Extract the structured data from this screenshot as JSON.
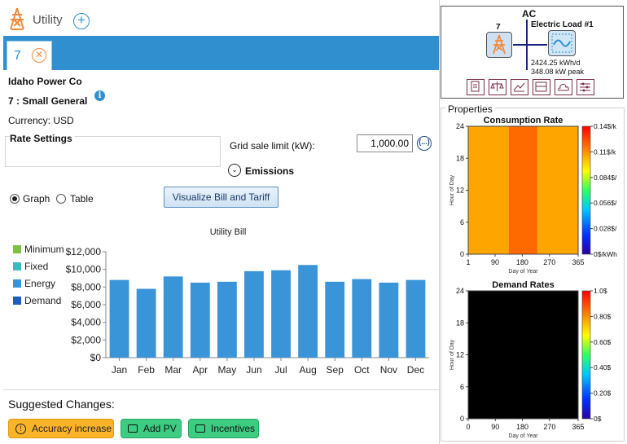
{
  "app": {
    "title": "Utility"
  },
  "tabs": [
    {
      "label": "7"
    }
  ],
  "utility": {
    "company": "Idaho Power Co",
    "rate_name": "7 : Small General",
    "currency_label": "Currency: USD"
  },
  "rate_settings": {
    "title": "Rate Settings",
    "grid_sale_limit_label": "Grid sale limit (kW):",
    "grid_sale_limit_value": "1,000.00",
    "more_button": "(...)",
    "emissions_label": "Emissions"
  },
  "view_mode": {
    "graph_label": "Graph",
    "table_label": "Table",
    "selected": "graph",
    "visualize_button": "Visualize Bill and Tariff"
  },
  "legend": [
    {
      "label": "Minimum",
      "color": "#7cc142"
    },
    {
      "label": "Fixed",
      "color": "#3bb9c1"
    },
    {
      "label": "Energy",
      "color": "#3a94d8"
    },
    {
      "label": "Demand",
      "color": "#1f5fb8"
    }
  ],
  "chart_data": [
    {
      "type": "bar",
      "title": "Utility Bill",
      "categories": [
        "Jan",
        "Feb",
        "Mar",
        "Apr",
        "May",
        "Jun",
        "Jul",
        "Aug",
        "Sep",
        "Oct",
        "Nov",
        "Dec"
      ],
      "values": [
        8800,
        7800,
        9200,
        8500,
        8600,
        9800,
        9900,
        10500,
        8600,
        8900,
        8500,
        8800
      ],
      "color": "#3a94d8",
      "ylim": [
        0,
        12000
      ],
      "yticks": [
        0,
        2000,
        4000,
        6000,
        8000,
        10000,
        12000
      ],
      "ytick_labels": [
        "$0",
        "$2,000",
        "$4,000",
        "$6,000",
        "$8,000",
        "$10,000",
        "$12,000"
      ]
    },
    {
      "type": "heatmap",
      "title": "Consumption Rate",
      "xlabel": "Day of Year",
      "ylabel": "Hour of Day",
      "xticks": [
        1,
        90,
        180,
        270,
        365
      ],
      "yticks": [
        0,
        6,
        12,
        18,
        24
      ],
      "bands": [
        {
          "day_from": 1,
          "day_to": 135,
          "color": "#ffa500",
          "rate": "$0.100/kWh"
        },
        {
          "day_from": 135,
          "day_to": 230,
          "color": "#ff6a00",
          "rate": "$0.115/kWh"
        },
        {
          "day_from": 230,
          "day_to": 365,
          "color": "#ffa500",
          "rate": "$0.100/kWh"
        }
      ],
      "colorbar_labels": [
        "0.14$/k",
        "0.11$/k",
        "0.084$/",
        "0.056$/",
        "0.028$/",
        "0$/kWh"
      ]
    },
    {
      "type": "heatmap",
      "title": "Demand Rates",
      "xlabel": "Day of Year",
      "ylabel": "Hour of Day",
      "xticks": [
        0,
        90,
        180,
        270,
        365
      ],
      "yticks": [
        0,
        6,
        12,
        18,
        24
      ],
      "bands": [
        {
          "day_from": 0,
          "day_to": 365,
          "color": "#000000",
          "rate": "$0"
        }
      ],
      "colorbar_labels": [
        "1.0$",
        "0.80$",
        "0.60$",
        "0.40$",
        "0.20$",
        "0$"
      ]
    }
  ],
  "suggestions": {
    "title": "Suggested Changes:",
    "items": [
      {
        "label": "Accuracy increase",
        "style": "orange",
        "icon": "alert-circle-icon"
      },
      {
        "label": "Add PV",
        "style": "green",
        "icon": "speech-bubble-icon"
      },
      {
        "label": "Incentives",
        "style": "green",
        "icon": "speech-bubble-icon"
      }
    ]
  },
  "diagram": {
    "bus_label": "AC",
    "grid_label": "7",
    "load_label": "Electric Load #1",
    "load_energy": "2424.25 kWh/d",
    "load_peak": "348.08 kW peak"
  },
  "properties": {
    "title": "Properties"
  }
}
